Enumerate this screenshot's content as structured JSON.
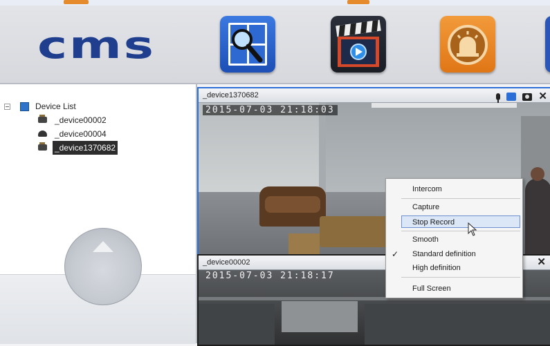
{
  "app": {
    "logo_text": "cms",
    "toolbar_buttons": [
      {
        "icon": "search-icon"
      },
      {
        "icon": "playback-icon"
      },
      {
        "icon": "alarm-icon"
      }
    ]
  },
  "device_tree": {
    "root_label": "Device List",
    "devices": [
      {
        "label": "_device00002",
        "icon": "camera-bullet-icon",
        "selected": false
      },
      {
        "label": "_device00004",
        "icon": "camera-dome-icon",
        "selected": false
      },
      {
        "label": "_device1370682",
        "icon": "camera-bullet-icon",
        "selected": true
      }
    ],
    "add_button": "+"
  },
  "video_panes": [
    {
      "title": "_device1370682",
      "osd_timestamp": "2015-07-03 21:18:03",
      "controls": [
        "microphone-icon",
        "record-icon",
        "snapshot-icon",
        "close-icon"
      ],
      "close_glyph": "✕"
    },
    {
      "title": "_device00002",
      "osd_timestamp": "2015-07-03 21:18:17",
      "controls": [
        "close-icon"
      ],
      "close_glyph": "✕"
    }
  ],
  "context_menu": {
    "items": [
      {
        "label": "Intercom"
      },
      {
        "label": "Capture"
      },
      {
        "label": "Stop Record",
        "highlighted": true
      },
      {
        "label": "Smooth"
      },
      {
        "label": "Standard definition",
        "checked": true
      },
      {
        "label": "High definition"
      },
      {
        "label": "Full Screen"
      }
    ],
    "check_glyph": "✓"
  }
}
